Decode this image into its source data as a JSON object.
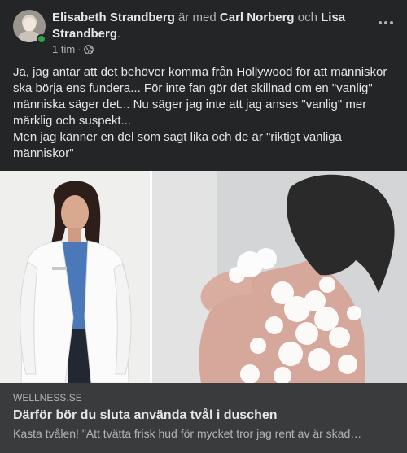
{
  "post": {
    "author": "Elisabeth Strandberg",
    "with_text": "är med",
    "tagged_1": "Carl Norberg",
    "and_text": "och",
    "tagged_2": "Lisa Strandberg",
    "period": ".",
    "time": "1 tim",
    "dot": "·",
    "audience_icon": "globe-icon",
    "more_icon": "more-horizontal-icon",
    "body": [
      "Ja, jag antar att det behöver komma från Hollywood för att människor ska börja ens fundera... För inte fan gör det skillnad om en \"vanlig\" människa säger det... Nu säger jag inte att jag anses \"vanlig\" mer märklig och suspekt...",
      "Men jag känner en del som sagt lika och de är \"riktigt vanliga människor\""
    ]
  },
  "link": {
    "domain": "WELLNESS.SE",
    "headline": "Därför bör du sluta använda tvål i duschen",
    "description": "Kasta tvålen! \"Att tvätta frisk hud för mycket tror jag rent av är skad…"
  },
  "colors": {
    "background": "#242526",
    "card": "#3a3b3c",
    "primary_text": "#e4e6eb",
    "secondary_text": "#b0b3b8",
    "online": "#31a24c"
  }
}
